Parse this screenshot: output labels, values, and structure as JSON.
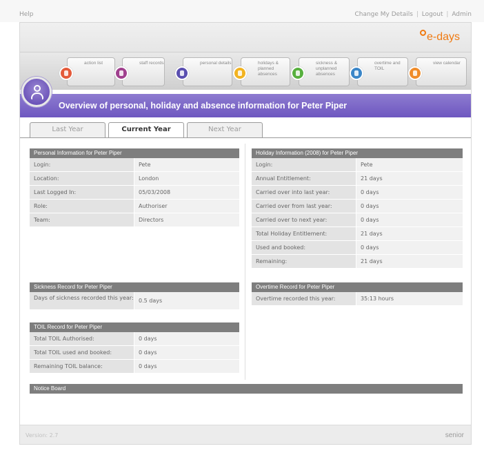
{
  "top": {
    "help": "Help",
    "change_details": "Change My Details",
    "logout": "Logout",
    "admin": "Admin"
  },
  "logo": "e-days",
  "nav": [
    {
      "label": "action list",
      "color": "#e45a3a"
    },
    {
      "label": "staff records",
      "color": "#a0408e"
    },
    {
      "label": "personal details",
      "color": "#5a4fb0"
    },
    {
      "label": "holidays & planned absences",
      "color": "#f2b321"
    },
    {
      "label": "sickness & unplanned absences",
      "color": "#57b03e"
    },
    {
      "label": "overtime and TOIL",
      "color": "#3a86c8"
    },
    {
      "label": "view calendar",
      "color": "#f08c2a"
    }
  ],
  "title": "Overview of personal, holiday and absence information for Peter Piper",
  "tabs": {
    "last": "Last Year",
    "current": "Current Year",
    "next": "Next Year"
  },
  "personal": {
    "heading": "Personal Information for Peter Piper",
    "rows": [
      {
        "label": "Login:",
        "value": "Pete"
      },
      {
        "label": "Location:",
        "value": "London"
      },
      {
        "label": "Last Logged In:",
        "value": "05/03/2008"
      },
      {
        "label": "Role:",
        "value": "Authoriser"
      },
      {
        "label": "Team:",
        "value": "Directors"
      }
    ]
  },
  "holiday": {
    "heading": "Holiday Information (2008) for Peter Piper",
    "rows": [
      {
        "label": "Login:",
        "value": "Pete"
      },
      {
        "label": "Annual Entitlement:",
        "value": "21 days"
      },
      {
        "label": "Carried over into last year:",
        "value": "0 days"
      },
      {
        "label": "Carried over from last year:",
        "value": "0 days"
      },
      {
        "label": "Carried over to next year:",
        "value": "0 days"
      },
      {
        "label": "Total Holiday Entitlement:",
        "value": "21 days"
      },
      {
        "label": "Used and booked:",
        "value": "0 days"
      },
      {
        "label": "Remaining:",
        "value": "21 days"
      }
    ]
  },
  "sickness": {
    "heading": "Sickness Record for Peter Piper",
    "rows": [
      {
        "label": "Days of sickness recorded this year:",
        "value": "0.5 days"
      }
    ]
  },
  "overtime": {
    "heading": "Overtime Record for Peter Piper",
    "rows": [
      {
        "label": "Overtime recorded this year:",
        "value": "35:13 hours"
      }
    ]
  },
  "toil": {
    "heading": "TOIL Record for Peter Piper",
    "rows": [
      {
        "label": "Total TOIL Authorised:",
        "value": "0 days"
      },
      {
        "label": "Total TOIL used and booked:",
        "value": "0 days"
      },
      {
        "label": "Remaining TOIL balance:",
        "value": "0 days"
      }
    ]
  },
  "notice": "Notice Board",
  "footer": {
    "version": "Version: 2.7",
    "brand": "senior"
  }
}
